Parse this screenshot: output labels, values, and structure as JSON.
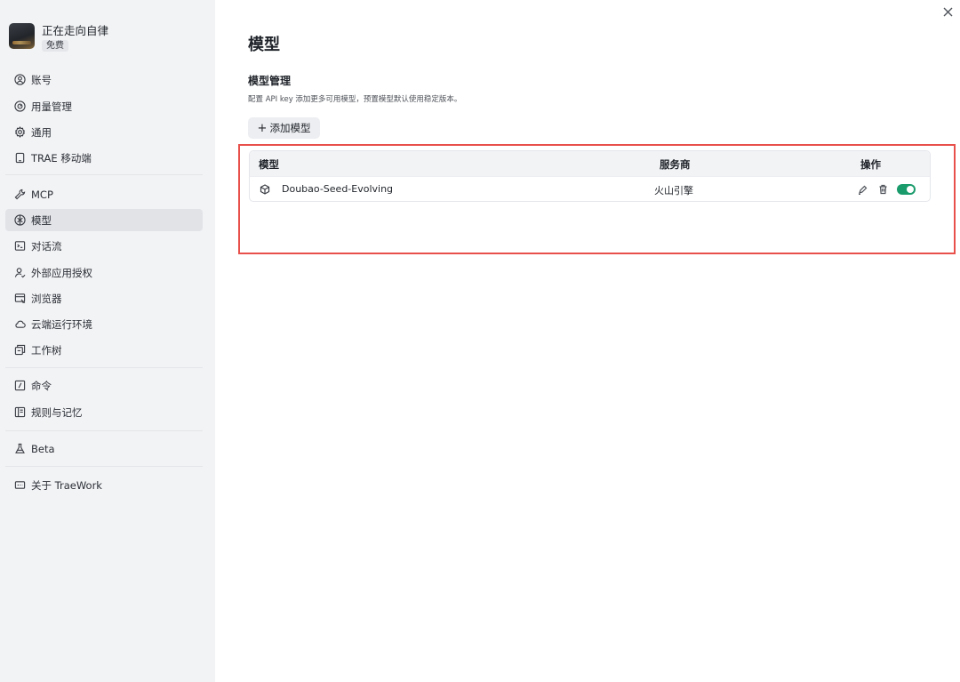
{
  "user": {
    "name": "正在走向自律",
    "plan": "免费"
  },
  "sidebar": {
    "items": [
      {
        "label": "账号",
        "icon": "account-icon"
      },
      {
        "label": "用量管理",
        "icon": "usage-icon"
      },
      {
        "label": "通用",
        "icon": "gear-icon"
      },
      {
        "label": "TRAE 移动端",
        "icon": "mobile-icon"
      },
      {
        "label": "MCP",
        "icon": "wrench-icon"
      },
      {
        "label": "模型",
        "icon": "model-icon",
        "active": true
      },
      {
        "label": "对话流",
        "icon": "terminal-icon"
      },
      {
        "label": "外部应用授权",
        "icon": "user-auth-icon"
      },
      {
        "label": "浏览器",
        "icon": "browser-icon"
      },
      {
        "label": "云端运行环境",
        "icon": "cloud-icon"
      },
      {
        "label": "工作树",
        "icon": "worktree-icon"
      },
      {
        "label": "命令",
        "icon": "command-icon"
      },
      {
        "label": "规则与记忆",
        "icon": "rules-icon"
      },
      {
        "label": "Beta",
        "icon": "flask-icon"
      },
      {
        "label": "关于 TraeWork",
        "icon": "about-icon"
      }
    ]
  },
  "main": {
    "title": "模型",
    "section_title": "模型管理",
    "section_desc": "配置 API key 添加更多可用模型，预置模型默认使用稳定版本。",
    "add_button": "添加模型",
    "table": {
      "headers": {
        "name": "模型",
        "provider": "服务商",
        "actions": "操作"
      },
      "rows": [
        {
          "name": "Doubao-Seed-Evolving",
          "provider": "火山引擎",
          "enabled": true
        }
      ]
    }
  },
  "colors": {
    "accent": "#1a9b6c",
    "highlight": "#e8504b",
    "sidebar_bg": "#f2f3f5"
  }
}
